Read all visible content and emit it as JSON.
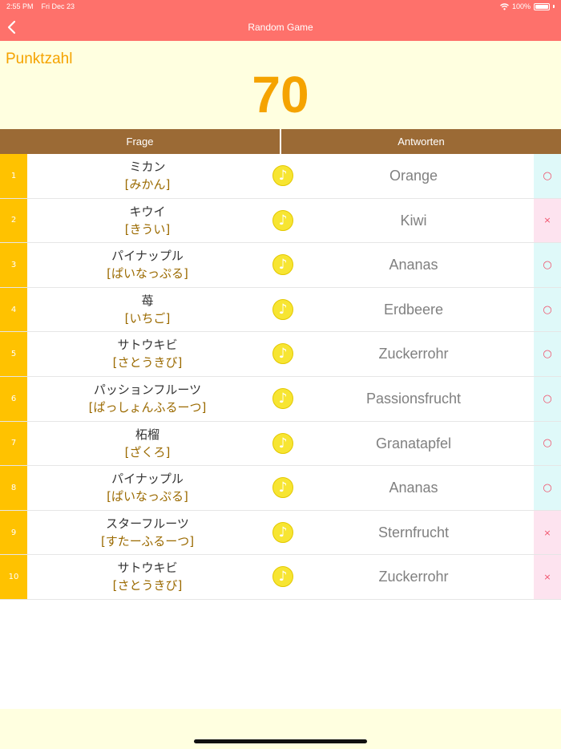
{
  "status_bar": {
    "time": "2:55 PM",
    "date": "Fri Dec 23",
    "battery": "100%"
  },
  "nav": {
    "title": "Random Game",
    "back_icon": "chevron-left-icon"
  },
  "score": {
    "label": "Punktzahl",
    "value": "70"
  },
  "table": {
    "question_header": "Frage",
    "answer_header": "Antworten",
    "rows": [
      {
        "num": "1",
        "kanji": "ミカン",
        "kana": "[みかん]",
        "answer": "Orange",
        "result": "○",
        "status": "correct"
      },
      {
        "num": "2",
        "kanji": "キウイ",
        "kana": "[きうい]",
        "answer": "Kiwi",
        "result": "×",
        "status": "wrong"
      },
      {
        "num": "3",
        "kanji": "パイナップル",
        "kana": "[ぱいなっぷる]",
        "answer": "Ananas",
        "result": "○",
        "status": "correct"
      },
      {
        "num": "4",
        "kanji": "苺",
        "kana": "[いちご]",
        "answer": "Erdbeere",
        "result": "○",
        "status": "correct"
      },
      {
        "num": "5",
        "kanji": "サトウキビ",
        "kana": "[さとうきび]",
        "answer": "Zuckerrohr",
        "result": "○",
        "status": "correct"
      },
      {
        "num": "6",
        "kanji": "パッションフルーツ",
        "kana": "[ぱっしょんふるーつ]",
        "answer": "Passionsfrucht",
        "result": "○",
        "status": "correct"
      },
      {
        "num": "7",
        "kanji": "柘榴",
        "kana": "[ざくろ]",
        "answer": "Granatapfel",
        "result": "○",
        "status": "correct"
      },
      {
        "num": "8",
        "kanji": "パイナップル",
        "kana": "[ぱいなっぷる]",
        "answer": "Ananas",
        "result": "○",
        "status": "correct"
      },
      {
        "num": "9",
        "kanji": "スターフルーツ",
        "kana": "[すたーふるーつ]",
        "answer": "Sternfrucht",
        "result": "×",
        "status": "wrong"
      },
      {
        "num": "10",
        "kanji": "サトウキビ",
        "kana": "[さとうきび]",
        "answer": "Zuckerrohr",
        "result": "×",
        "status": "wrong"
      }
    ]
  },
  "colors": {
    "accent": "#fe716b",
    "score": "#f5a300",
    "header": "#9b6a35",
    "number_column": "#ffc200",
    "correct_bg": "#dff9f9",
    "wrong_bg": "#fde3ef"
  }
}
